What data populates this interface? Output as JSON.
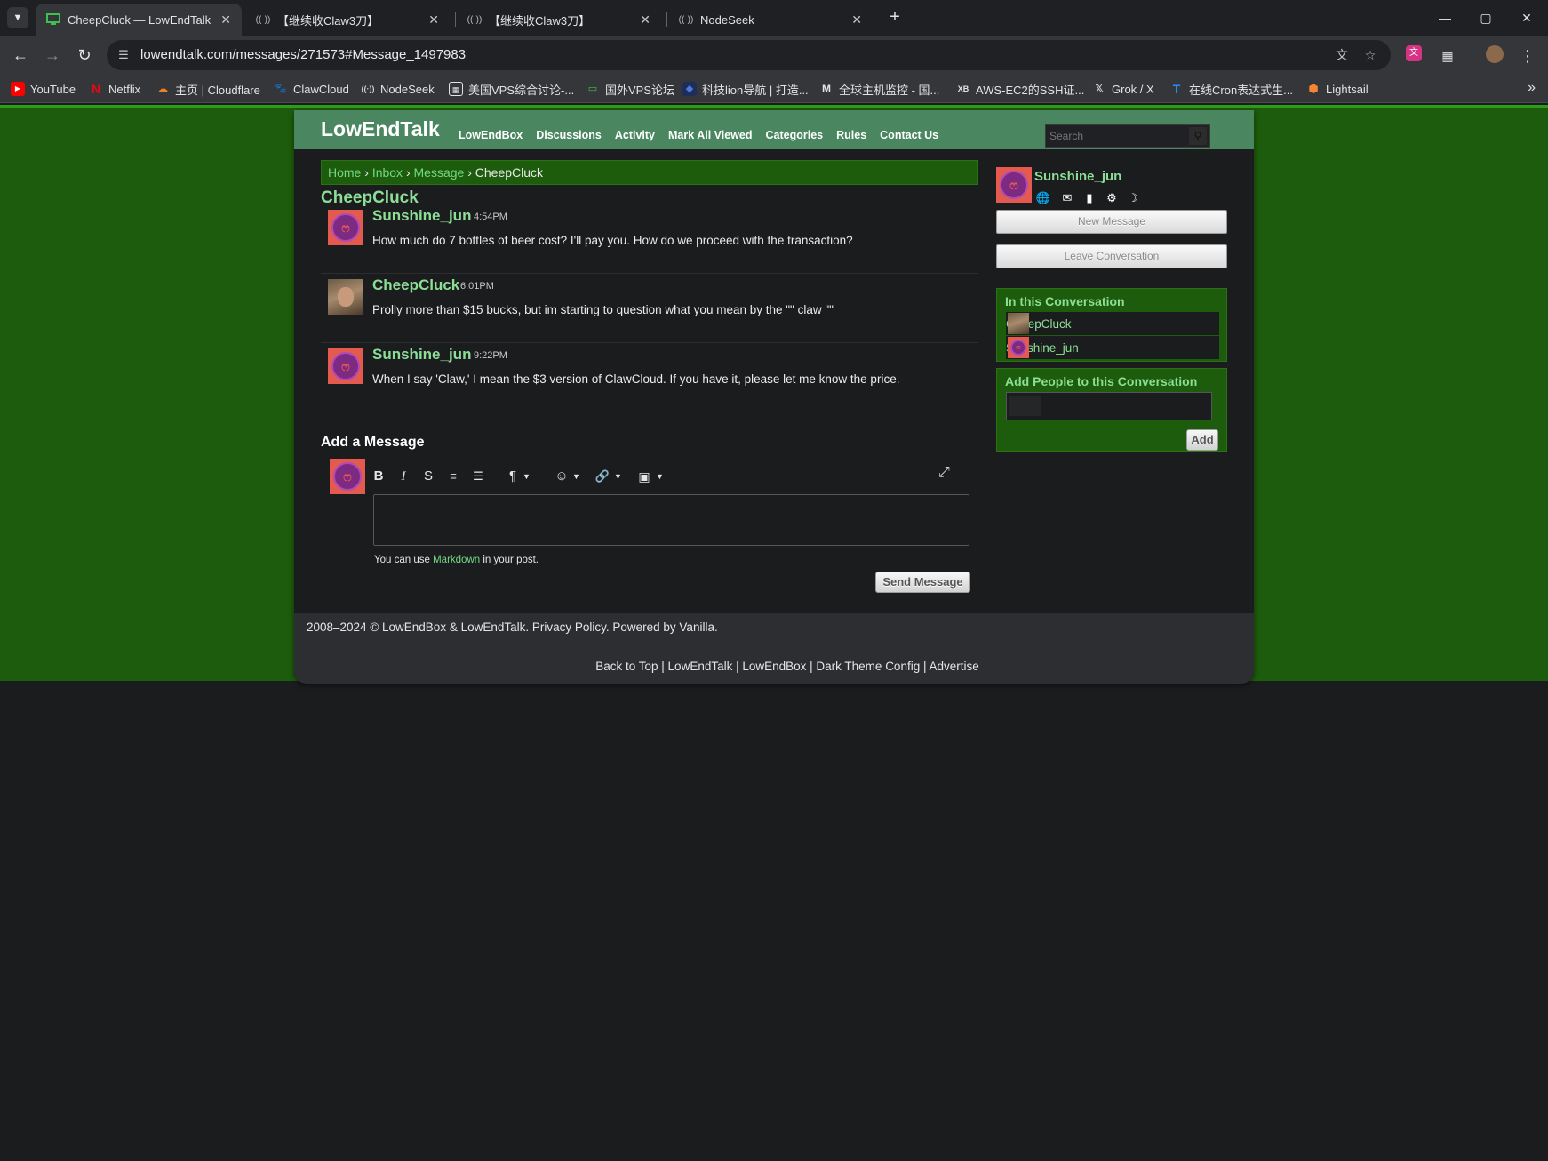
{
  "browser": {
    "tabs": [
      {
        "title": "CheepCluck — LowEndTalk",
        "active": true,
        "icon": "monitor-icon"
      },
      {
        "title": "【继续收Claw3刀】",
        "active": false,
        "icon": "broadcast-icon"
      },
      {
        "title": "【继续收Claw3刀】",
        "active": false,
        "icon": "broadcast-icon"
      },
      {
        "title": "NodeSeek",
        "active": false,
        "icon": "broadcast-icon"
      }
    ],
    "new_tab": "+",
    "url": "lowendtalk.com/messages/271573#Message_1497983",
    "bookmarks": [
      {
        "label": "YouTube",
        "icon": "youtube-icon",
        "color": "#ff0000"
      },
      {
        "label": "Netflix",
        "icon": "netflix-icon",
        "color": "#e50914"
      },
      {
        "label": "主页 | Cloudflare",
        "icon": "cloudflare-icon",
        "color": "#f38020"
      },
      {
        "label": "ClawCloud",
        "icon": "paw-icon",
        "color": "#e3e3e3"
      },
      {
        "label": "NodeSeek",
        "icon": "broadcast-icon",
        "color": "#e3e3e3"
      },
      {
        "label": "美国VPS综合讨论-...",
        "icon": "qr-icon",
        "color": "#e3e3e3"
      },
      {
        "label": "国外VPS论坛",
        "icon": "monitor-icon",
        "color": "#3fbf4f"
      },
      {
        "label": "科技lion导航 | 打造...",
        "icon": "lion-icon",
        "color": "#4a7bd8"
      },
      {
        "label": "全球主机监控 - 国...",
        "icon": "m-icon",
        "color": "#e3e3e3"
      },
      {
        "label": "AWS-EC2的SSH证...",
        "icon": "xb-icon",
        "color": "#e3e3e3"
      },
      {
        "label": "Grok / X",
        "icon": "x-icon",
        "color": "#e3e3e3"
      },
      {
        "label": "在线Cron表达式生...",
        "icon": "t-icon",
        "color": "#1e90ff"
      },
      {
        "label": "Lightsail",
        "icon": "cube-icon",
        "color": "#f58536"
      }
    ]
  },
  "site": {
    "title": "LowEndTalk",
    "nav": [
      "LowEndBox",
      "Discussions",
      "Activity",
      "Mark All Viewed",
      "Categories",
      "Rules",
      "Contact Us"
    ],
    "search_placeholder": "Search"
  },
  "breadcrumb": {
    "home": "Home",
    "inbox": "Inbox",
    "message": "Message",
    "current": "CheepCluck",
    "sep": "›"
  },
  "conversation_title": "CheepCluck",
  "messages": [
    {
      "author": "Sunshine_jun",
      "time": "4:54PM",
      "body": "How much do 7 bottles of beer cost? I'll pay you. How do we proceed with the transaction?"
    },
    {
      "author": "CheepCluck",
      "time": "6:01PM",
      "body": "Prolly more than $15 bucks, but im starting to question what you mean by the \"\" claw \"\""
    },
    {
      "author": "Sunshine_jun",
      "time": "9:22PM",
      "body": "When I say 'Claw,' I mean the $3 version of ClawCloud. If you have it, please let me know the price."
    }
  ],
  "composer": {
    "heading": "Add a Message",
    "hint_pre": "You can use",
    "hint_link": "Markdown",
    "hint_post": "in your post.",
    "send_label": "Send Message"
  },
  "sidebar": {
    "username": "Sunshine_jun",
    "new_message": "New Message",
    "leave_conversation": "Leave Conversation",
    "participants_heading": "In this Conversation",
    "participants": [
      "CheepCluck",
      "Sunshine_jun"
    ],
    "add_people_heading": "Add People to this Conversation",
    "add_label": "Add"
  },
  "footer": {
    "copyright": "2008–2024 © LowEndBox & LowEndTalk. Privacy Policy. Powered by Vanilla.",
    "links": "Back to Top | LowEndTalk | LowEndBox | Dark Theme Config | Advertise"
  }
}
